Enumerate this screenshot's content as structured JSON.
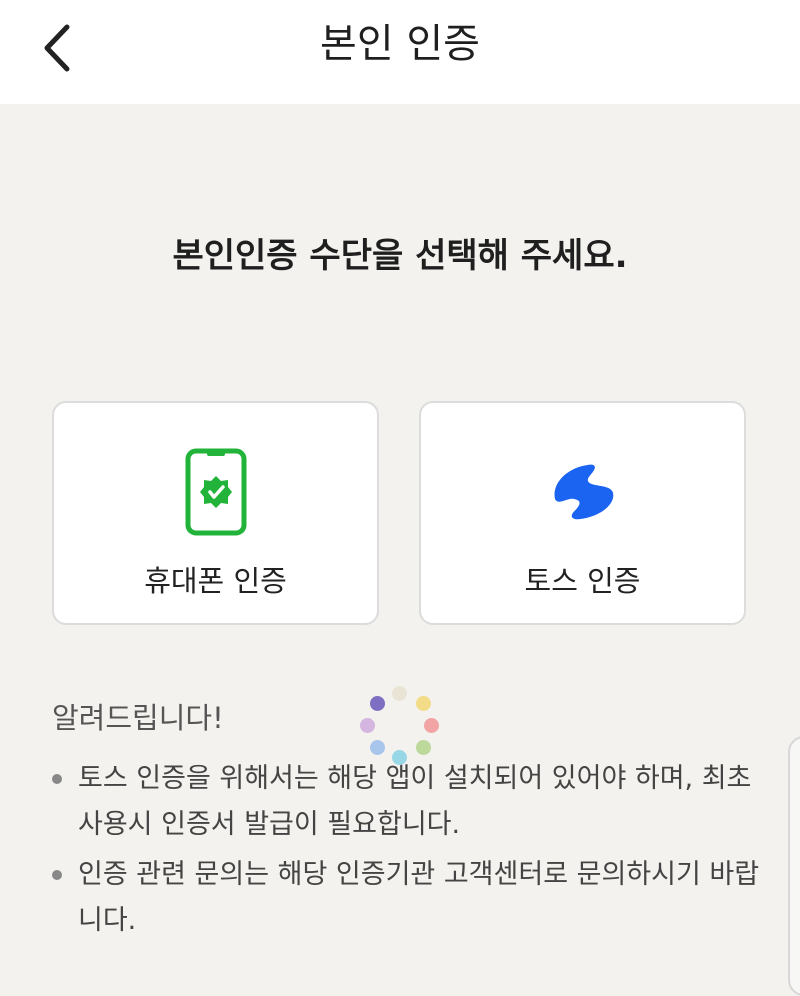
{
  "header": {
    "title": "본인 인증",
    "back_icon": "chevron-left-icon"
  },
  "headline": "본인인증 수단을 선택해 주세요.",
  "methods": [
    {
      "label": "휴대폰 인증",
      "icon": "phone-verified-icon",
      "color": "#22b43a"
    },
    {
      "label": "토스 인증",
      "icon": "toss-logo-icon",
      "color": "#1b64f2"
    }
  ],
  "notice": {
    "title": "알려드립니다!",
    "items": [
      "토스 인증을 위해서는 해당 앱이 설치되어 있어야 하며, 최초 사용시 인증서 발급이 필요합니다.",
      "인증 관련 문의는 해당 인증기관 고객센터로 문의하시기 바랍니다."
    ]
  },
  "spinner": {
    "icon": "loading-spinner-icon",
    "colors": [
      "#e9e4d6",
      "#f2dc88",
      "#f2a4a4",
      "#bcd89a",
      "#98d7e6",
      "#a8c6ec",
      "#d4b6e0",
      "#7f6fc2"
    ]
  }
}
